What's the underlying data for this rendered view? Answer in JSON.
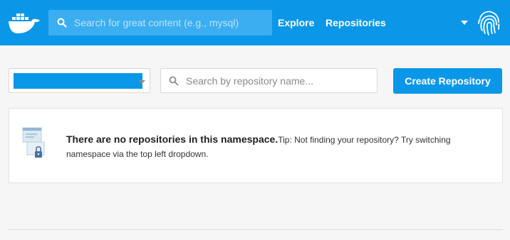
{
  "navbar": {
    "logo_icon": "docker-whale-icon",
    "search_placeholder": "Search for great content (e.g., mysql)",
    "links": {
      "explore": "Explore",
      "repositories": "Repositories"
    },
    "account_icon": "fingerprint-icon",
    "colors": {
      "background": "#0b97e8",
      "search_bg": "#3aaef0"
    }
  },
  "toolbar": {
    "namespace_select": {
      "value": "",
      "icon": "chevron-down-icon"
    },
    "repo_search_placeholder": "Search by repository name...",
    "create_button_label": "Create Repository"
  },
  "empty_state": {
    "heading": "There are no repositories in this namespace.",
    "tip": "Tip: Not finding your repository? Try switching namespace via the top left dropdown.",
    "illustration_icon": "locked-document-icon"
  }
}
